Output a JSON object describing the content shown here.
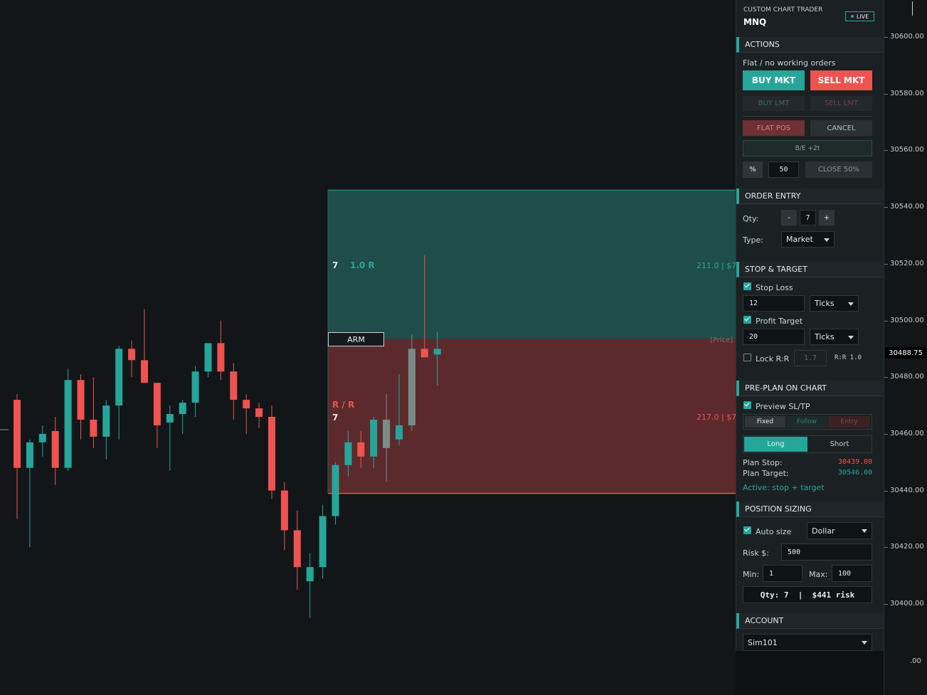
{
  "panel": {
    "subtitle": "CUSTOM CHART TRADER",
    "symbol": "MNQ",
    "live_badge": "LIVE",
    "sections": {
      "actions": "ACTIONS",
      "order_entry": "ORDER ENTRY",
      "stop_target": "STOP & TARGET",
      "preplan": "PRE-PLAN ON CHART",
      "sizing": "POSITION SIZING",
      "account": "ACCOUNT"
    },
    "actions": {
      "status": "Flat / no working orders",
      "buy_mkt": "BUY MKT",
      "sell_mkt": "SELL MKT",
      "buy_lmt": "BUY LMT",
      "sell_lmt": "SELL LMT",
      "flat_pos": "FLAT POS",
      "cancel": "CANCEL",
      "breakeven": "B/E +2t",
      "percent_btn": "%",
      "percent_value": "50",
      "close_pct": "CLOSE 50%"
    },
    "order_entry": {
      "qty_label": "Qty:",
      "minus": "-",
      "qty": "7",
      "plus": "+",
      "type_label": "Type:",
      "type_value": "Market"
    },
    "stop_target": {
      "stop_label": "Stop Loss",
      "stop_value": "12",
      "stop_unit": "Ticks",
      "target_label": "Profit Target",
      "target_value": "20",
      "target_unit": "Ticks",
      "lock_label": "Lock R:R",
      "lock_value": "1.7",
      "rr_readout": "R:R 1.0"
    },
    "preplan": {
      "preview_label": "Preview SL/TP",
      "mode_fixed": "Fixed",
      "mode_follow": "Follow",
      "mode_entry": "Entry",
      "long": "Long",
      "short": "Short",
      "plan_stop_label": "Plan Stop:",
      "plan_stop_value": "30439.00",
      "plan_target_label": "Plan Target:",
      "plan_target_value": "30546.00",
      "active_text": "Active: stop + target"
    },
    "sizing": {
      "auto_label": "Auto size",
      "auto_mode": "Dollar",
      "risk_label": "Risk $:",
      "risk_value": "500",
      "min_label": "Min:",
      "min_value": "1",
      "max_label": "Max:",
      "max_value": "100",
      "summary": "Qty: 7  |  $441 risk"
    },
    "account": {
      "value": "Sim101"
    }
  },
  "chart": {
    "target_zone": {
      "qty": "7",
      "r_label": "1.0 R",
      "readout": "211.0 | $7"
    },
    "stop_zone": {
      "rr_label": "R / R",
      "qty": "7",
      "readout": "217.0 | $7"
    },
    "arm_button": "ARM",
    "price_tag": "[Price]",
    "axis_ticks": [
      "30600.00",
      "30580.00",
      "30560.00",
      "30540.00",
      "30520.00",
      "30500.00",
      "30480.00",
      "30460.00",
      "30440.00",
      "30420.00",
      "30400.00"
    ],
    "current_price": "30488.75",
    "axis_bottom_partial": ".00",
    "colors": {
      "up": "#26a69a",
      "down": "#ef5350",
      "neutral": "#7a8c86",
      "target_zone": "#1f4d49",
      "stop_zone": "#5c2a2d"
    }
  },
  "chart_data": {
    "type": "candlestick",
    "y_axis": {
      "ticks": [
        30600,
        30580,
        30560,
        30540,
        30520,
        30500,
        30480,
        30460,
        30440,
        30420,
        30400
      ],
      "current": 30488.75
    },
    "levels": {
      "target_top": 30546.0,
      "entry": 30493.5,
      "stop_bottom": 30439.0
    },
    "candles": [
      {
        "o": 30472,
        "h": 30474,
        "l": 30430,
        "c": 30448
      },
      {
        "o": 30448,
        "h": 30458,
        "l": 30420,
        "c": 30457
      },
      {
        "o": 30457,
        "h": 30463,
        "l": 30452,
        "c": 30460
      },
      {
        "o": 30461,
        "h": 30466,
        "l": 30442,
        "c": 30448
      },
      {
        "o": 30448,
        "h": 30483,
        "l": 30447,
        "c": 30479
      },
      {
        "o": 30479,
        "h": 30481,
        "l": 30458,
        "c": 30465
      },
      {
        "o": 30465,
        "h": 30480,
        "l": 30455,
        "c": 30459
      },
      {
        "o": 30459,
        "h": 30472,
        "l": 30451,
        "c": 30470
      },
      {
        "o": 30470,
        "h": 30491,
        "l": 30458,
        "c": 30490
      },
      {
        "o": 30490,
        "h": 30493,
        "l": 30480,
        "c": 30486
      },
      {
        "o": 30486,
        "h": 30504,
        "l": 30478,
        "c": 30478
      },
      {
        "o": 30478,
        "h": 30475,
        "l": 30455,
        "c": 30463
      },
      {
        "o": 30464,
        "h": 30470,
        "l": 30447,
        "c": 30467
      },
      {
        "o": 30467,
        "h": 30472,
        "l": 30460,
        "c": 30471
      },
      {
        "o": 30471,
        "h": 30484,
        "l": 30466,
        "c": 30482
      },
      {
        "o": 30482,
        "h": 30490,
        "l": 30480,
        "c": 30492
      },
      {
        "o": 30492,
        "h": 30500,
        "l": 30479,
        "c": 30482
      },
      {
        "o": 30482,
        "h": 30485,
        "l": 30465,
        "c": 30472
      },
      {
        "o": 30472,
        "h": 30474,
        "l": 30460,
        "c": 30469
      },
      {
        "o": 30469,
        "h": 30471,
        "l": 30462,
        "c": 30466
      },
      {
        "o": 30466,
        "h": 30470,
        "l": 30437,
        "c": 30440
      },
      {
        "o": 30440,
        "h": 30443,
        "l": 30419,
        "c": 30426
      },
      {
        "o": 30426,
        "h": 30433,
        "l": 30405,
        "c": 30413
      },
      {
        "o": 30408,
        "h": 30418,
        "l": 30395,
        "c": 30413
      },
      {
        "o": 30413,
        "h": 30435,
        "l": 30409,
        "c": 30431
      },
      {
        "o": 30431,
        "h": 30450,
        "l": 30428,
        "c": 30449
      },
      {
        "o": 30449,
        "h": 30461,
        "l": 30445,
        "c": 30457
      },
      {
        "o": 30457,
        "h": 30461,
        "l": 30448,
        "c": 30452
      },
      {
        "o": 30452,
        "h": 30466,
        "l": 30448,
        "c": 30465
      },
      {
        "o": 30465,
        "h": 30474,
        "l": 30443,
        "c": 30455
      },
      {
        "o": 30458,
        "h": 30481,
        "l": 30456,
        "c": 30463
      },
      {
        "o": 30463,
        "h": 30495,
        "l": 30461,
        "c": 30490
      },
      {
        "o": 30490,
        "h": 30523,
        "l": 30488,
        "c": 30487
      },
      {
        "o": 30488,
        "h": 30496,
        "l": 30477,
        "c": 30490
      }
    ]
  }
}
